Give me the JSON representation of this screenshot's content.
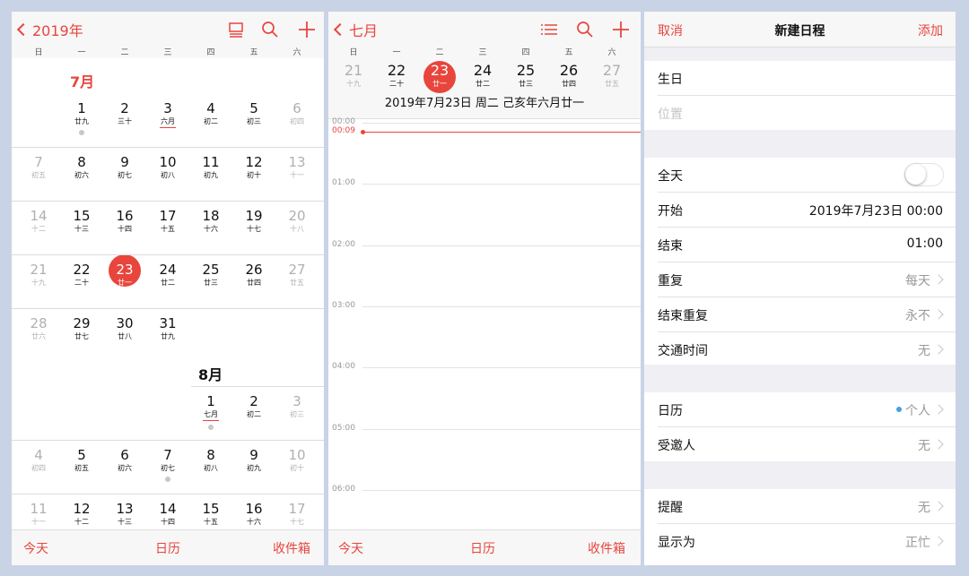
{
  "colors": {
    "accent": "#e8453c",
    "calendar_dot": "#4a9fe0",
    "background": "#c9d3e6"
  },
  "month_view": {
    "back_label": "2019年",
    "toolbar_icons": [
      "list-view-icon",
      "search-icon",
      "plus-icon"
    ],
    "weekdays": [
      "日",
      "一",
      "二",
      "三",
      "四",
      "五",
      "六"
    ],
    "july": {
      "label": "7月",
      "rows": [
        [
          {
            "n": "1",
            "l": "廿九",
            "dot": true
          },
          {
            "n": "2",
            "l": "三十"
          },
          {
            "n": "3",
            "l": "六月",
            "u": true
          },
          {
            "n": "4",
            "l": "初二"
          },
          {
            "n": "5",
            "l": "初三"
          },
          {
            "n": "6",
            "l": "初四",
            "dim": true
          }
        ],
        [
          {
            "n": "7",
            "l": "初五",
            "dim": true
          },
          {
            "n": "8",
            "l": "初六"
          },
          {
            "n": "9",
            "l": "初七"
          },
          {
            "n": "10",
            "l": "初八"
          },
          {
            "n": "11",
            "l": "初九"
          },
          {
            "n": "12",
            "l": "初十"
          },
          {
            "n": "13",
            "l": "十一",
            "dim": true
          }
        ],
        [
          {
            "n": "14",
            "l": "十二",
            "dim": true
          },
          {
            "n": "15",
            "l": "十三"
          },
          {
            "n": "16",
            "l": "十四"
          },
          {
            "n": "17",
            "l": "十五"
          },
          {
            "n": "18",
            "l": "十六"
          },
          {
            "n": "19",
            "l": "十七"
          },
          {
            "n": "20",
            "l": "十八",
            "dim": true
          }
        ],
        [
          {
            "n": "21",
            "l": "十九",
            "dim": true
          },
          {
            "n": "22",
            "l": "二十"
          },
          {
            "n": "23",
            "l": "廿一",
            "today": true
          },
          {
            "n": "24",
            "l": "廿二"
          },
          {
            "n": "25",
            "l": "廿三"
          },
          {
            "n": "26",
            "l": "廿四"
          },
          {
            "n": "27",
            "l": "廿五",
            "dim": true
          }
        ],
        [
          {
            "n": "28",
            "l": "廿六",
            "dim": true
          },
          {
            "n": "29",
            "l": "廿七"
          },
          {
            "n": "30",
            "l": "廿八"
          },
          {
            "n": "31",
            "l": "廿九"
          }
        ]
      ]
    },
    "august": {
      "label": "8月",
      "rows": [
        [
          {
            "n": "1",
            "l": "七月",
            "u": true,
            "dot": true
          },
          {
            "n": "2",
            "l": "初二"
          },
          {
            "n": "3",
            "l": "初三",
            "dim": true
          }
        ],
        [
          {
            "n": "4",
            "l": "初四",
            "dim": true
          },
          {
            "n": "5",
            "l": "初五"
          },
          {
            "n": "6",
            "l": "初六"
          },
          {
            "n": "7",
            "l": "初七",
            "dot": true
          },
          {
            "n": "8",
            "l": "初八"
          },
          {
            "n": "9",
            "l": "初九"
          },
          {
            "n": "10",
            "l": "初十",
            "dim": true
          }
        ],
        [
          {
            "n": "11",
            "l": "十一",
            "dim": true
          },
          {
            "n": "12",
            "l": "十二"
          },
          {
            "n": "13",
            "l": "十三"
          },
          {
            "n": "14",
            "l": "十四"
          },
          {
            "n": "15",
            "l": "十五"
          },
          {
            "n": "16",
            "l": "十六"
          },
          {
            "n": "17",
            "l": "十七",
            "dim": true
          }
        ]
      ]
    },
    "tabs": {
      "today": "今天",
      "calendars": "日历",
      "inbox": "收件箱"
    }
  },
  "day_view": {
    "back_label": "七月",
    "toolbar_icons": [
      "list-icon",
      "search-icon",
      "plus-icon"
    ],
    "weekdays": [
      "日",
      "一",
      "二",
      "三",
      "四",
      "五",
      "六"
    ],
    "week": [
      {
        "n": "21",
        "l": "十九",
        "dim": true
      },
      {
        "n": "22",
        "l": "二十"
      },
      {
        "n": "23",
        "l": "廿一",
        "sel": true
      },
      {
        "n": "24",
        "l": "廿二"
      },
      {
        "n": "25",
        "l": "廿三"
      },
      {
        "n": "26",
        "l": "廿四"
      },
      {
        "n": "27",
        "l": "廿五",
        "dim": true
      }
    ],
    "date_line": "2019年7月23日 周二   己亥年六月廿一",
    "hours": [
      "00:00",
      "01:00",
      "02:00",
      "03:00",
      "04:00",
      "05:00",
      "06:00"
    ],
    "current_time": "00:09",
    "tabs": {
      "today": "今天",
      "calendars": "日历",
      "inbox": "收件箱"
    }
  },
  "new_event": {
    "cancel": "取消",
    "title": "新建日程",
    "add": "添加",
    "event_title": "生日",
    "location_placeholder": "位置",
    "all_day_label": "全天",
    "all_day_on": false,
    "start_label": "开始",
    "start_value": "2019年7月23日    00:00",
    "end_label": "结束",
    "end_value": "01:00",
    "repeat_label": "重复",
    "repeat_value": "每天",
    "end_repeat_label": "结束重复",
    "end_repeat_value": "永不",
    "travel_label": "交通时间",
    "travel_value": "无",
    "calendar_label": "日历",
    "calendar_value": "个人",
    "invitees_label": "受邀人",
    "invitees_value": "无",
    "alert_label": "提醒",
    "alert_value": "无",
    "show_as_label": "显示为",
    "show_as_value": "正忙"
  }
}
